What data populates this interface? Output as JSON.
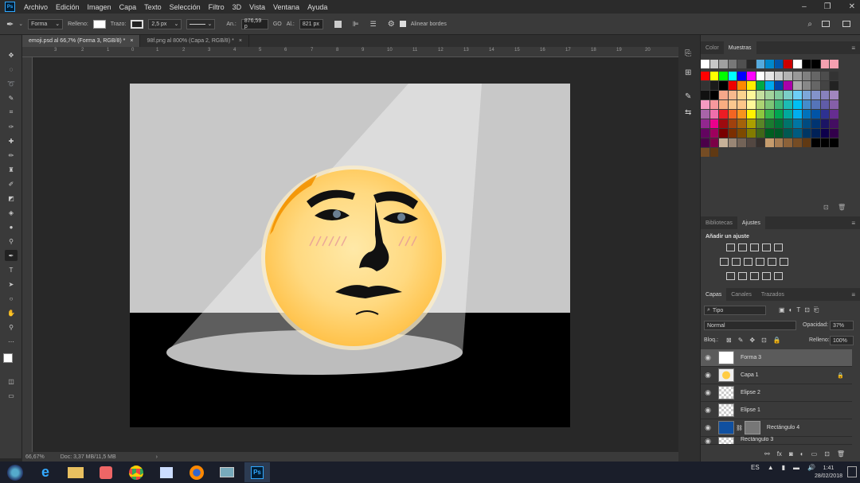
{
  "menu": [
    "Archivo",
    "Edición",
    "Imagen",
    "Capa",
    "Texto",
    "Selección",
    "Filtro",
    "3D",
    "Vista",
    "Ventana",
    "Ayuda"
  ],
  "options": {
    "mode": "Forma",
    "fill_label": "Relleno:",
    "stroke_label": "Trazo:",
    "stroke_size": "2,5 px",
    "width_label": "An.:",
    "width_value": "876,59 p",
    "link": "GO",
    "height_label": "Al.:",
    "height_value": "821 px",
    "align_edges": "Alinear bordes"
  },
  "tabs": [
    {
      "label": "emoji.psd al 66,7% (Forma 3, RGB/8) *",
      "close": "×"
    },
    {
      "label": "98f.png al 800% (Capa 2, RGB/8) *",
      "close": "×"
    }
  ],
  "ruler_ticks": [
    "3",
    "2",
    "1",
    "0",
    "1",
    "2",
    "3",
    "4",
    "5",
    "6",
    "7",
    "8",
    "9",
    "10",
    "11",
    "12",
    "13",
    "14",
    "15",
    "16",
    "17",
    "18",
    "19",
    "20"
  ],
  "status": {
    "zoom": "66,67%",
    "doc": "Doc: 3,37 MB/11,5 MB"
  },
  "color_panel": {
    "tab1": "Color",
    "tab2": "Muestras"
  },
  "swatches": {
    "top": [
      "#ffffff",
      "#c8c8c8",
      "#a0a0a0",
      "#787878",
      "#505050",
      "#282828",
      "#55aadd",
      "#0088cc",
      "#0055aa",
      "#cc0000",
      "#ffffff",
      "#000000",
      "#000000",
      "#f4a0b0",
      "#f4a0b0"
    ],
    "rows": [
      [
        "#ff0000",
        "#ffff00",
        "#00ff00",
        "#00ffff",
        "#0000ff",
        "#ff00ff",
        "#ffffff",
        "#e6e6e6",
        "#cccccc",
        "#b3b3b3",
        "#999999",
        "#808080",
        "#666666",
        "#4d4d4d",
        "#333333"
      ],
      [
        "#333333",
        "#1a1a1a",
        "#000000",
        "#ee0000",
        "#ff8800",
        "#ffee00",
        "#00aa44",
        "#00aaee",
        "#0044aa",
        "#aa00aa",
        "#aaaaaa",
        "#888888",
        "#666666",
        "#444444",
        "#222222"
      ],
      [
        "#111111",
        "#000000",
        "#f5a88a",
        "#f7b98d",
        "#fbd38e",
        "#fff79a",
        "#c5df9f",
        "#a3d39c",
        "#81ca9d",
        "#7bcdc8",
        "#6dcff6",
        "#7da7d9",
        "#8393ca",
        "#8781bd",
        "#a186be"
      ],
      [
        "#f49ac1",
        "#f6989d",
        "#f9ad81",
        "#fbc78f",
        "#fdc689",
        "#fff799",
        "#acd373",
        "#7cc576",
        "#3cb878",
        "#1cbbb4",
        "#00bff3",
        "#448ccb",
        "#5574b9",
        "#605ca8",
        "#855fa8"
      ],
      [
        "#a864a8",
        "#f06eaa",
        "#ed1c24",
        "#f26522",
        "#f7941d",
        "#fff200",
        "#8dc73f",
        "#39b54a",
        "#00a651",
        "#00a99d",
        "#00aeef",
        "#0072bc",
        "#0054a6",
        "#2e3192",
        "#662d91"
      ],
      [
        "#92278f",
        "#ec008c",
        "#9e0b0f",
        "#a0410d",
        "#a3620a",
        "#aba000",
        "#598527",
        "#197b30",
        "#007236",
        "#00746b",
        "#0076a3",
        "#004b80",
        "#003471",
        "#1b1464",
        "#440e62"
      ],
      [
        "#630460",
        "#9e005d",
        "#790000",
        "#7b2e00",
        "#7d4900",
        "#827b00",
        "#406618",
        "#005e20",
        "#005826",
        "#005952",
        "#005b7f",
        "#003663",
        "#002157",
        "#0d004c",
        "#32004b"
      ],
      [
        "#4b0049",
        "#7b0046",
        "#c7b299",
        "#998675",
        "#736357",
        "#534741",
        "#37302d",
        "#c69c6d",
        "#a67c52",
        "#8c6239",
        "#754c24",
        "#603913",
        "#000000",
        "#000000",
        "#000000"
      ]
    ],
    "last": [
      "#754c24",
      "#603913"
    ]
  },
  "adjust_panel": {
    "tab1": "Bibliotecas",
    "tab2": "Ajustes",
    "heading": "Añadir un ajuste"
  },
  "layers_panel": {
    "tab1": "Capas",
    "tab2": "Canales",
    "tab3": "Trazados",
    "filter": "Tipo",
    "blend": "Normal",
    "opacity_label": "Opacidad:",
    "opacity": "37%",
    "lock_label": "Bloq.:",
    "fill_label": "Relleno:",
    "fill": "100%",
    "layers": [
      {
        "name": "Forma 3",
        "selected": true
      },
      {
        "name": "Capa 1",
        "selected": false
      },
      {
        "name": "Elipse 2",
        "selected": false
      },
      {
        "name": "Elipse 1",
        "selected": false
      },
      {
        "name": "Rectángulo 4",
        "selected": false
      },
      {
        "name": "Rectángulo 3",
        "selected": false
      }
    ]
  },
  "taskbar": {
    "lang": "ES",
    "time": "1:41",
    "date": "28/02/2018"
  }
}
